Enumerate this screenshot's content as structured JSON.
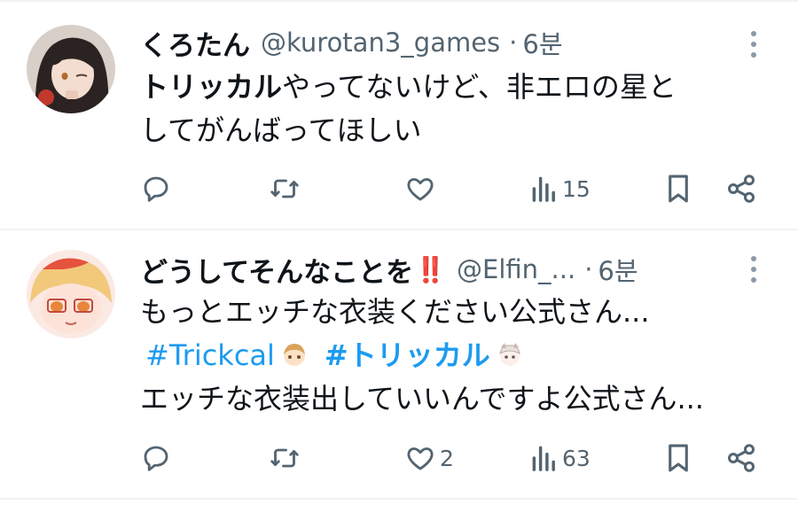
{
  "tweets": [
    {
      "display_name": "くろたん",
      "handle": "@kurotan3_games",
      "separator": "·",
      "time": "6분",
      "text_bold": "トリッカル",
      "text_line1_rest": "やってないけど、非エロの星と",
      "text_line2": "してがんばってほしい",
      "actions": {
        "reply_count": "",
        "retweet_count": "",
        "like_count": "",
        "views_count": "15"
      },
      "avatar_icon": "dark-haired-anime-girl-avatar"
    },
    {
      "display_name": "どうしてそんなことを",
      "name_emoji": "‼️",
      "handle": "@Elfin_...",
      "separator": "·",
      "time": "6분",
      "text_line1": "もっとエッチな衣装ください公式さん...",
      "hashtag1": "#Trickcal",
      "hashtag2": "#トリッカル",
      "text_line3": "エッチな衣装出していいんですよ公式さん...",
      "actions": {
        "reply_count": "",
        "retweet_count": "",
        "like_count": "2",
        "views_count": "63"
      },
      "avatar_icon": "blonde-anime-girl-avatar"
    }
  ],
  "colors": {
    "text": "#0f1419",
    "secondary": "#536471",
    "link": "#1d9bf0",
    "divider": "#eff3f4"
  }
}
